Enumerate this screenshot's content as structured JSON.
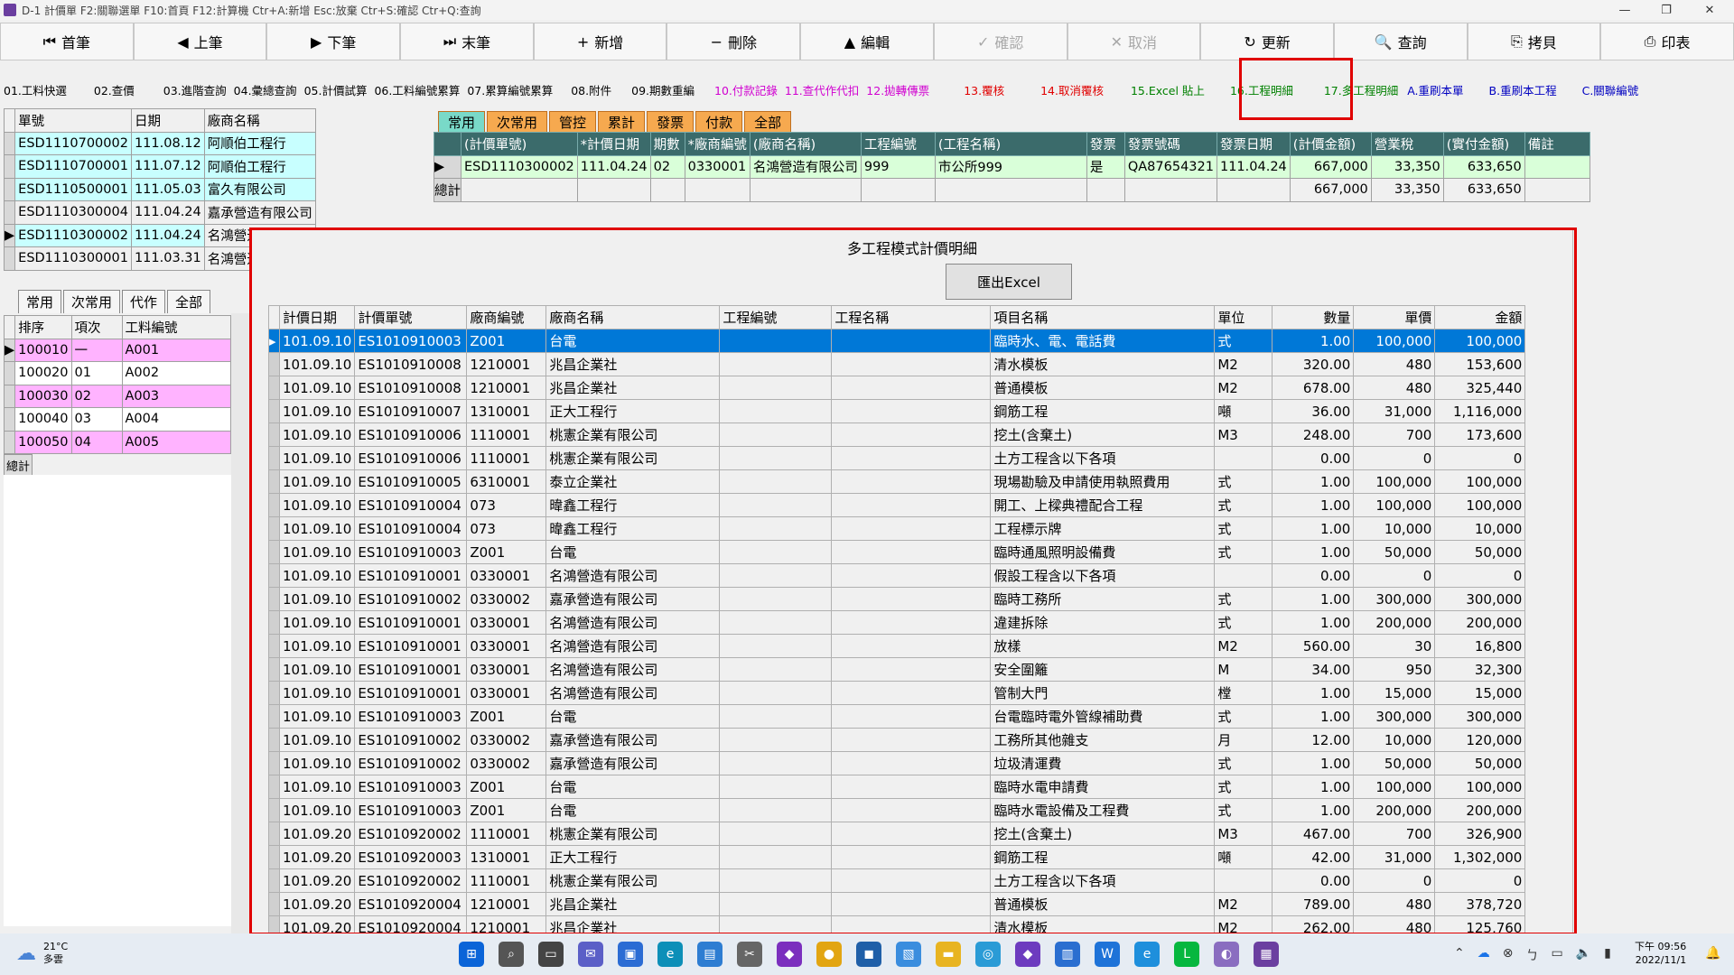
{
  "window": {
    "title": "D-1 計價單   F2:關聯選單  F10:首頁   F12:計算機  Ctr+A:新增  Esc:放棄   Ctr+S:確認  Ctr+Q:查詢"
  },
  "toolbar": [
    {
      "icon": "first-record-icon",
      "glyph": "⏮",
      "label": "首筆",
      "enabled": true
    },
    {
      "icon": "prev-record-icon",
      "glyph": "◀",
      "label": "上筆",
      "enabled": true
    },
    {
      "icon": "next-record-icon",
      "glyph": "▶",
      "label": "下筆",
      "enabled": true
    },
    {
      "icon": "last-record-icon",
      "glyph": "⏭",
      "label": "末筆",
      "enabled": true
    },
    {
      "icon": "plus-icon",
      "glyph": "+",
      "label": "新增",
      "enabled": true
    },
    {
      "icon": "minus-icon",
      "glyph": "−",
      "label": "刪除",
      "enabled": true
    },
    {
      "icon": "caret-up-icon",
      "glyph": "▲",
      "label": "編輯",
      "enabled": true
    },
    {
      "icon": "check-icon",
      "glyph": "✓",
      "label": "確認",
      "enabled": false
    },
    {
      "icon": "cross-icon",
      "glyph": "✕",
      "label": "取消",
      "enabled": false
    },
    {
      "icon": "refresh-icon",
      "glyph": "↻",
      "label": "更新",
      "enabled": true
    },
    {
      "icon": "search-icon",
      "glyph": "🔍",
      "label": "查詢",
      "enabled": true
    },
    {
      "icon": "copy-icon",
      "glyph": "⎘",
      "label": "拷貝",
      "enabled": true
    },
    {
      "icon": "printer-icon",
      "glyph": "⎙",
      "label": "印表",
      "enabled": true
    }
  ],
  "menu": [
    {
      "label": "01.工料快選",
      "color": "#000000"
    },
    {
      "label": "02.查價",
      "color": "#000000"
    },
    {
      "label": "03.進階查詢",
      "color": "#000000"
    },
    {
      "label": "04.彙總查詢",
      "color": "#000000"
    },
    {
      "label": "05.計價試算",
      "color": "#000000"
    },
    {
      "label": "06.工料編號累算",
      "color": "#000000"
    },
    {
      "label": "07.累算編號累算",
      "color": "#000000"
    },
    {
      "label": "08.附件",
      "color": "#000000"
    },
    {
      "label": "09.期數重編",
      "color": "#000000"
    },
    {
      "label": "10.付款記錄",
      "color": "#d000d0"
    },
    {
      "label": "11.查代作代扣",
      "color": "#d000d0"
    },
    {
      "label": "12.拋轉傳票",
      "color": "#d000d0"
    },
    {
      "label": "13.覆核",
      "color": "#e00000"
    },
    {
      "label": "14.取消覆核",
      "color": "#e00000"
    },
    {
      "label": "15.Excel 貼上",
      "color": "#008000"
    },
    {
      "label": "16.工程明細",
      "color": "#008000"
    },
    {
      "label": "17.多工程明細",
      "color": "#008000"
    },
    {
      "label": "A.重刷本單",
      "color": "#0000c0"
    },
    {
      "label": "B.重刷本工程",
      "color": "#0000c0"
    },
    {
      "label": "C.關聯編號",
      "color": "#0000c0"
    }
  ],
  "left_list": {
    "headers": [
      "單號",
      "日期",
      "廠商名稱"
    ],
    "rows": [
      [
        "ESD1110700002",
        "111.08.12",
        "阿順伯工程行"
      ],
      [
        "ESD1110700001",
        "111.07.12",
        "阿順伯工程行"
      ],
      [
        "ESD1110500001",
        "111.05.03",
        "富久有限公司"
      ],
      [
        "ESD1110300004",
        "111.04.24",
        "嘉承營造有限公司"
      ],
      [
        "ESD1110300002",
        "111.04.24",
        "名鴻營造有限公司"
      ],
      [
        "ESD1110300001",
        "111.03.31",
        "名鴻營造有限公司"
      ]
    ]
  },
  "left_tabs": [
    "常用",
    "次常用",
    "代作",
    "全部"
  ],
  "left_items": {
    "headers": [
      "排序",
      "項次",
      "工料編號"
    ],
    "rows": [
      [
        "100010",
        "一",
        "A001"
      ],
      [
        "100020",
        "01",
        "A002"
      ],
      [
        "100030",
        "02",
        "A003"
      ],
      [
        "100040",
        "03",
        "A004"
      ],
      [
        "100050",
        "04",
        "A005"
      ]
    ],
    "total_label": "總計"
  },
  "right_tabs": [
    "常用",
    "次常用",
    "管控",
    "累計",
    "發票",
    "付款",
    "全部"
  ],
  "right_grid": {
    "headers": [
      "(計價單號)",
      "*計價日期",
      "期數",
      "*廠商編號",
      "(廠商名稱)",
      "工程編號",
      "(工程名稱)",
      "發票",
      "發票號碼",
      "發票日期",
      "(計價金額)",
      "營業稅",
      "(實付金額)",
      "備註"
    ],
    "row": [
      "ESD1110300002",
      "111.04.24",
      "02",
      "0330001",
      "名鴻營造有限公司",
      "999",
      "市公所999",
      "是",
      "QA87654321",
      "111.04.24",
      "667,000",
      "33,350",
      "633,650",
      ""
    ],
    "totals": [
      "667,000",
      "33,350",
      "633,650"
    ],
    "total_label": "總計"
  },
  "dialog": {
    "title": "多工程模式計價明細",
    "export_button": "匯出Excel",
    "headers": [
      "計價日期",
      "計價單號",
      "廠商編號",
      "廠商名稱",
      "工程編號",
      "工程名稱",
      "項目名稱",
      "單位",
      "數量",
      "單價",
      "金額"
    ],
    "rows": [
      [
        "101.09.10",
        "ES1010910003",
        "Z001",
        "台電",
        "",
        "",
        "臨時水、電、電話費",
        "式",
        "1.00",
        "100,000",
        "100,000"
      ],
      [
        "101.09.10",
        "ES1010910008",
        "1210001",
        "兆昌企業社",
        "",
        "",
        "清水模板",
        "M2",
        "320.00",
        "480",
        "153,600"
      ],
      [
        "101.09.10",
        "ES1010910008",
        "1210001",
        "兆昌企業社",
        "",
        "",
        "普通模板",
        "M2",
        "678.00",
        "480",
        "325,440"
      ],
      [
        "101.09.10",
        "ES1010910007",
        "1310001",
        "正大工程行",
        "",
        "",
        "鋼筋工程",
        "噸",
        "36.00",
        "31,000",
        "1,116,000"
      ],
      [
        "101.09.10",
        "ES1010910006",
        "1110001",
        "桃憲企業有限公司",
        "",
        "",
        "挖土(含棄土)",
        "M3",
        "248.00",
        "700",
        "173,600"
      ],
      [
        "101.09.10",
        "ES1010910006",
        "1110001",
        "桃憲企業有限公司",
        "",
        "",
        "土方工程含以下各項",
        "",
        "0.00",
        "0",
        "0"
      ],
      [
        "101.09.10",
        "ES1010910005",
        "6310001",
        "泰立企業社",
        "",
        "",
        "現場勘驗及申請使用執照費用",
        "式",
        "1.00",
        "100,000",
        "100,000"
      ],
      [
        "101.09.10",
        "ES1010910004",
        "073",
        "暐鑫工程行",
        "",
        "",
        "開工、上樑典禮配合工程",
        "式",
        "1.00",
        "100,000",
        "100,000"
      ],
      [
        "101.09.10",
        "ES1010910004",
        "073",
        "暐鑫工程行",
        "",
        "",
        "工程標示牌",
        "式",
        "1.00",
        "10,000",
        "10,000"
      ],
      [
        "101.09.10",
        "ES1010910003",
        "Z001",
        "台電",
        "",
        "",
        "臨時通風照明設備費",
        "式",
        "1.00",
        "50,000",
        "50,000"
      ],
      [
        "101.09.10",
        "ES1010910001",
        "0330001",
        "名鴻營造有限公司",
        "",
        "",
        "假設工程含以下各項",
        "",
        "0.00",
        "0",
        "0"
      ],
      [
        "101.09.10",
        "ES1010910002",
        "0330002",
        "嘉承營造有限公司",
        "",
        "",
        "臨時工務所",
        "式",
        "1.00",
        "300,000",
        "300,000"
      ],
      [
        "101.09.10",
        "ES1010910001",
        "0330001",
        "名鴻營造有限公司",
        "",
        "",
        "違建拆除",
        "式",
        "1.00",
        "200,000",
        "200,000"
      ],
      [
        "101.09.10",
        "ES1010910001",
        "0330001",
        "名鴻營造有限公司",
        "",
        "",
        "放樣",
        "M2",
        "560.00",
        "30",
        "16,800"
      ],
      [
        "101.09.10",
        "ES1010910001",
        "0330001",
        "名鴻營造有限公司",
        "",
        "",
        "安全圍籬",
        "M",
        "34.00",
        "950",
        "32,300"
      ],
      [
        "101.09.10",
        "ES1010910001",
        "0330001",
        "名鴻營造有限公司",
        "",
        "",
        "管制大門",
        "樘",
        "1.00",
        "15,000",
        "15,000"
      ],
      [
        "101.09.10",
        "ES1010910003",
        "Z001",
        "台電",
        "",
        "",
        "台電臨時電外管線補助費",
        "式",
        "1.00",
        "300,000",
        "300,000"
      ],
      [
        "101.09.10",
        "ES1010910002",
        "0330002",
        "嘉承營造有限公司",
        "",
        "",
        "工務所其他雜支",
        "月",
        "12.00",
        "10,000",
        "120,000"
      ],
      [
        "101.09.10",
        "ES1010910002",
        "0330002",
        "嘉承營造有限公司",
        "",
        "",
        "垃圾清運費",
        "式",
        "1.00",
        "50,000",
        "50,000"
      ],
      [
        "101.09.10",
        "ES1010910003",
        "Z001",
        "台電",
        "",
        "",
        "臨時水電申請費",
        "式",
        "1.00",
        "100,000",
        "100,000"
      ],
      [
        "101.09.10",
        "ES1010910003",
        "Z001",
        "台電",
        "",
        "",
        "臨時水電設備及工程費",
        "式",
        "1.00",
        "200,000",
        "200,000"
      ],
      [
        "101.09.20",
        "ES1010920002",
        "1110001",
        "桃憲企業有限公司",
        "",
        "",
        "挖土(含棄土)",
        "M3",
        "467.00",
        "700",
        "326,900"
      ],
      [
        "101.09.20",
        "ES1010920003",
        "1310001",
        "正大工程行",
        "",
        "",
        "鋼筋工程",
        "噸",
        "42.00",
        "31,000",
        "1,302,000"
      ],
      [
        "101.09.20",
        "ES1010920002",
        "1110001",
        "桃憲企業有限公司",
        "",
        "",
        "土方工程含以下各項",
        "",
        "0.00",
        "0",
        "0"
      ],
      [
        "101.09.20",
        "ES1010920004",
        "1210001",
        "兆昌企業社",
        "",
        "",
        "普通模板",
        "M2",
        "789.00",
        "480",
        "378,720"
      ],
      [
        "101.09.20",
        "ES1010920004",
        "1210001",
        "兆昌企業社",
        "",
        "",
        "清水模板",
        "M2",
        "262.00",
        "480",
        "125,760"
      ]
    ]
  },
  "taskbar": {
    "weather_temp": "21°C",
    "weather_desc": "多雲",
    "time": "下午 09:56",
    "date": "2022/11/1",
    "apps": [
      {
        "icon": "windows-start-icon",
        "color": "#0a64d8",
        "glyph": "⊞"
      },
      {
        "icon": "search-icon",
        "color": "#555555",
        "glyph": "⌕"
      },
      {
        "icon": "task-view-icon",
        "color": "#444444",
        "glyph": "▭"
      },
      {
        "icon": "teams-chat-icon",
        "color": "#5b5fc7",
        "glyph": "✉"
      },
      {
        "icon": "store-icon",
        "color": "#2b6cd4",
        "glyph": "▣"
      },
      {
        "icon": "edge-icon",
        "color": "#0c8fb8",
        "glyph": "e"
      },
      {
        "icon": "remote-desktop-icon",
        "color": "#2d7dd2",
        "glyph": "▤"
      },
      {
        "icon": "tools-icon",
        "color": "#666666",
        "glyph": "✂"
      },
      {
        "icon": "visual-studio-icon",
        "color": "#7b2fbe",
        "glyph": "◆"
      },
      {
        "icon": "chrome-icon",
        "color": "#e2a512",
        "glyph": "●"
      },
      {
        "icon": "app-blue-icon",
        "color": "#1f5fa8",
        "glyph": "◼"
      },
      {
        "icon": "photos-icon",
        "color": "#3a8dde",
        "glyph": "▧"
      },
      {
        "icon": "file-explorer-icon",
        "color": "#e8b422",
        "glyph": "▬"
      },
      {
        "icon": "globe-icon",
        "color": "#2a9bd6",
        "glyph": "◎"
      },
      {
        "icon": "vs-code-icon",
        "color": "#6d3bbf",
        "glyph": "◆"
      },
      {
        "icon": "notepad-icon",
        "color": "#2a6ed0",
        "glyph": "▥"
      },
      {
        "icon": "word-icon",
        "color": "#1e73d8",
        "glyph": "W"
      },
      {
        "icon": "ie-icon",
        "color": "#1e8fdc",
        "glyph": "e"
      },
      {
        "icon": "line-icon",
        "color": "#06b73f",
        "glyph": "L"
      },
      {
        "icon": "app-gradient-icon",
        "color": "#8a6dc0",
        "glyph": "◐"
      },
      {
        "icon": "erp-app-icon",
        "color": "#6b3fa0",
        "glyph": "▦"
      }
    ]
  }
}
